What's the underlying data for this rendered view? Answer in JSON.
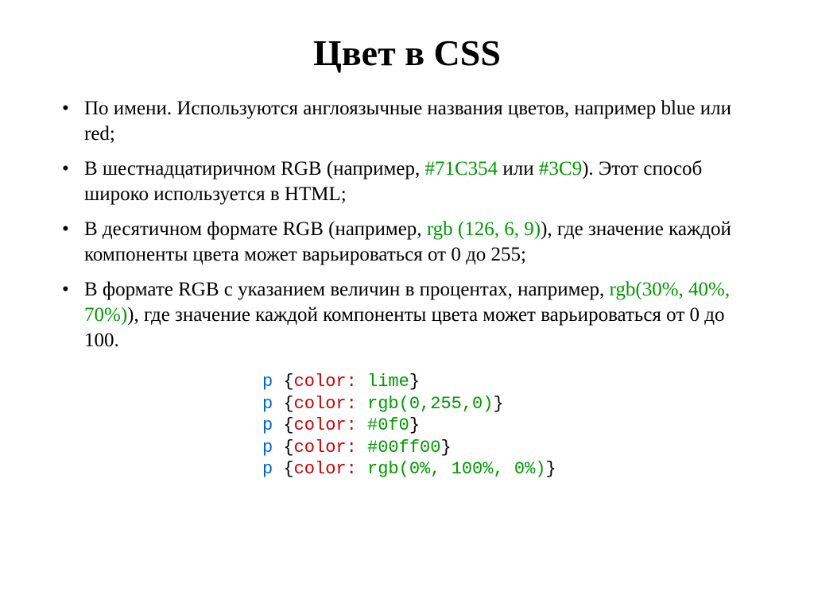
{
  "title": "Цвет в CSS",
  "bullets": [
    {
      "pre": "По имени. Используются англоязычные названия цветов, например blue или red;",
      "colored": "",
      "post": ""
    },
    {
      "pre": "В шестнадцатиричном RGB (например, ",
      "colored": "#71С354",
      "mid": " или ",
      "colored2": "#3С9",
      "post": "). Этот способ широко используется в HTML;"
    },
    {
      "pre": "В десятичном формате RGB (например, ",
      "colored": "rgb (126, 6, 9)",
      "post": "), где значение каждой компоненты цвета может варьироваться от 0 до 255;"
    },
    {
      "pre": "В формате RGB с указанием величин в процентах, например, ",
      "colored": "rgb(30%, 40%, 70%)",
      "post": "), где значение каждой компоненты цвета может варьироваться от 0 до 100."
    }
  ],
  "code": [
    {
      "selector": "p",
      "open": " {",
      "prop": "color:",
      "space": " ",
      "value": "lime",
      "close": "}"
    },
    {
      "selector": "p",
      "open": " {",
      "prop": "color:",
      "space": " ",
      "value": "rgb(0,255,0)",
      "close": "}"
    },
    {
      "selector": "p",
      "open": " {",
      "prop": "color:",
      "space": " ",
      "value": "#0f0",
      "close": "}"
    },
    {
      "selector": "p",
      "open": " {",
      "prop": "color:",
      "space": " ",
      "value": "#00ff00",
      "close": "}"
    },
    {
      "selector": "p",
      "open": " {",
      "prop": "color:",
      "space": " ",
      "value": "rgb(0%, 100%, 0%)",
      "close": "}"
    }
  ]
}
